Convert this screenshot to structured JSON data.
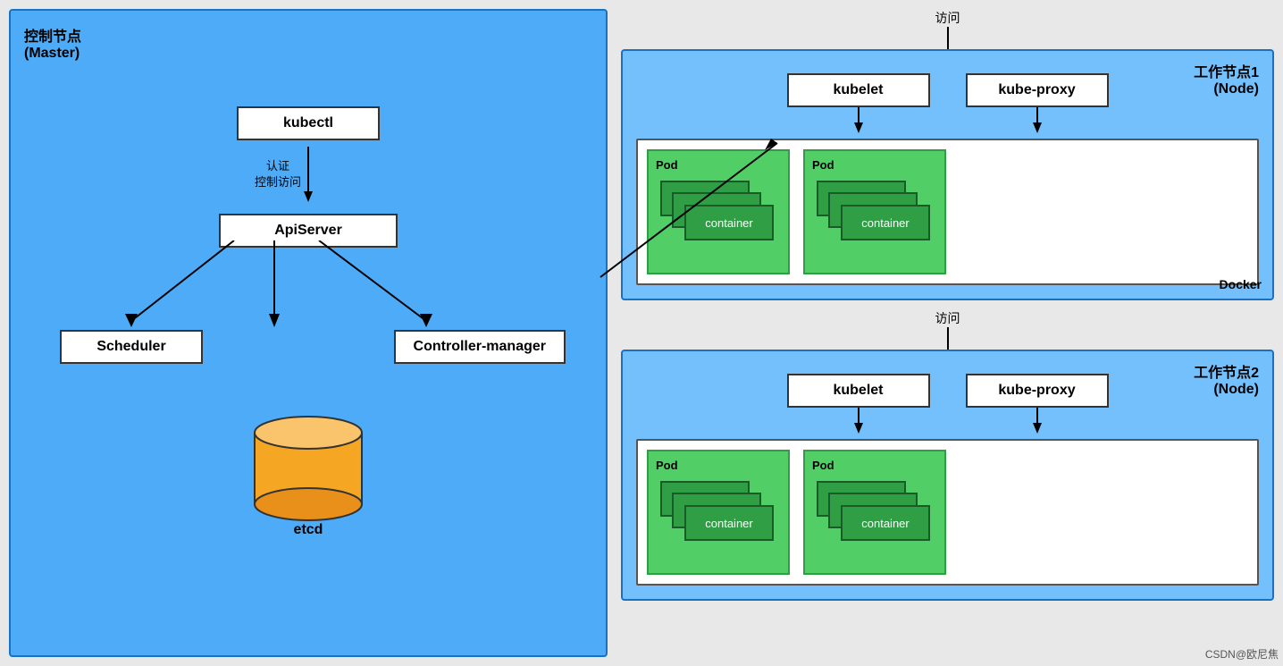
{
  "master": {
    "title_line1": "控制节点",
    "title_line2": "(Master)",
    "kubectl": "kubectl",
    "auth_label_line1": "认证",
    "auth_label_line2": "控制访问",
    "apiserver": "ApiServer",
    "scheduler": "Scheduler",
    "controller_manager": "Controller-manager",
    "etcd": "etcd"
  },
  "node1": {
    "title_line1": "工作节点1",
    "title_line2": "(Node)",
    "access": "访问",
    "kubelet": "kubelet",
    "kube_proxy": "kube-proxy",
    "pod1_label": "Pod",
    "pod2_label": "Pod",
    "container": "container",
    "docker": "Docker"
  },
  "node2": {
    "title_line1": "工作节点2",
    "title_line2": "(Node)",
    "access": "访问",
    "kubelet": "kubelet",
    "kube_proxy": "kube-proxy",
    "pod1_label": "Pod",
    "pod2_label": "Pod",
    "container": "container"
  },
  "watermark": "CSDN@欧尼焦"
}
